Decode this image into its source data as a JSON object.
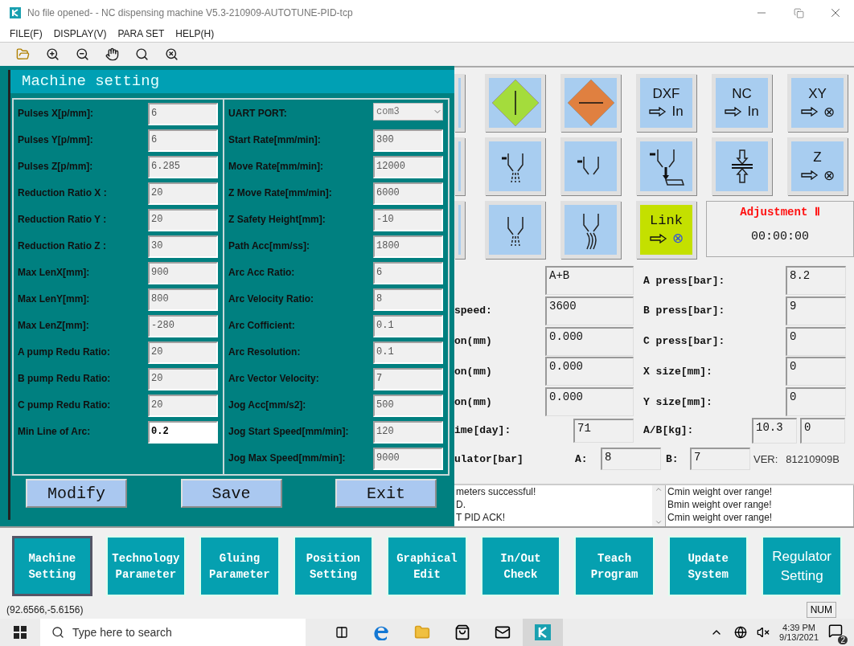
{
  "window": {
    "title": "No file opened- - NC dispensing machine V5.3-210909-AUTOTUNE-PID-tcp"
  },
  "menu": [
    "FILE(F)",
    "DISPLAY(V)",
    "PARA SET",
    "HELP(H)"
  ],
  "dialog": {
    "title": "Machine setting",
    "left": [
      {
        "label": "Pulses X[p/mm]:",
        "value": "6",
        "disabled": true
      },
      {
        "label": "Pulses Y[p/mm]:",
        "value": "6",
        "disabled": true
      },
      {
        "label": "Pulses Z[p/mm]:",
        "value": "6.285",
        "disabled": true
      },
      {
        "label": "Reduction Ratio X :",
        "value": "20",
        "disabled": true
      },
      {
        "label": "Reduction Ratio Y :",
        "value": "20",
        "disabled": true
      },
      {
        "label": "Reduction Ratio Z :",
        "value": "30",
        "disabled": true
      },
      {
        "label": "Max LenX[mm]:",
        "value": "900",
        "disabled": true
      },
      {
        "label": "Max LenY[mm]:",
        "value": "800",
        "disabled": true
      },
      {
        "label": "Max LenZ[mm]:",
        "value": "-280",
        "disabled": true
      },
      {
        "label": "A pump Redu Ratio:",
        "value": "20",
        "disabled": true
      },
      {
        "label": "B pump Redu Ratio:",
        "value": "20",
        "disabled": true
      },
      {
        "label": "C pump Redu Ratio:",
        "value": "20",
        "disabled": true
      },
      {
        "label": "Min Line of Arc:",
        "value": "0.2",
        "disabled": false
      }
    ],
    "right": [
      {
        "kind": "select",
        "label": "UART PORT:",
        "value": "com3",
        "disabled": true
      },
      {
        "kind": "field",
        "label": "Start Rate[mm/min]:",
        "value": "300",
        "disabled": true
      },
      {
        "kind": "field",
        "label": "Move Rate[mm/min]:",
        "value": "12000",
        "disabled": true
      },
      {
        "kind": "field",
        "label": "Z Move Rate[mm/min]:",
        "value": "6000",
        "disabled": true
      },
      {
        "kind": "field",
        "label": "Z Safety Height[mm]:",
        "value": "-10",
        "disabled": true
      },
      {
        "kind": "field",
        "label": "Path Acc[mm/ss]:",
        "value": "1800",
        "disabled": true
      },
      {
        "kind": "field",
        "label": "Arc Acc Ratio:",
        "value": "6",
        "disabled": true
      },
      {
        "kind": "field",
        "label": "Arc Velocity Ratio:",
        "value": "8",
        "disabled": true
      },
      {
        "kind": "field",
        "label": "Arc Cofficient:",
        "value": "0.1",
        "disabled": true
      },
      {
        "kind": "field",
        "label": "Arc Resolution:",
        "value": "0.1",
        "disabled": true
      },
      {
        "kind": "field",
        "label": "Arc Vector Velocity:",
        "value": "7",
        "disabled": true
      },
      {
        "kind": "field",
        "label": "Jog Acc[mm/s2]:",
        "value": "500",
        "disabled": true
      },
      {
        "kind": "field",
        "label": "Jog Start Speed[mm/min]:",
        "value": "120",
        "disabled": true
      },
      {
        "kind": "field",
        "label": "Jog Max Speed[mm/min]:",
        "value": "9000",
        "disabled": true
      }
    ],
    "buttons": [
      "Modify",
      "Save",
      "Exit"
    ]
  },
  "tools": [
    {
      "kind": "partial",
      "highlighted": false
    },
    {
      "kind": "diamond-vertical",
      "color": "#a4dc3c",
      "highlighted": false
    },
    {
      "kind": "diamond-horizontal",
      "color": "#e08040",
      "highlighted": false
    },
    {
      "kind": "text",
      "label": "DXF",
      "target": "In",
      "highlighted": false
    },
    {
      "kind": "text",
      "label": "NC",
      "target": "In",
      "highlighted": false
    },
    {
      "kind": "text",
      "label": "XY",
      "target": "⊗",
      "highlighted": false
    },
    {
      "kind": "partial",
      "highlighted": false
    },
    {
      "kind": "nozzle-spray",
      "highlighted": false
    },
    {
      "kind": "nozzle",
      "highlighted": false
    },
    {
      "kind": "nozzle-dispense",
      "highlighted": false
    },
    {
      "kind": "press",
      "highlighted": false
    },
    {
      "kind": "text",
      "label": "Z",
      "target": "⊗",
      "highlighted": false
    },
    {
      "kind": "partial",
      "highlighted": false
    },
    {
      "kind": "nozzle-drip",
      "highlighted": false
    },
    {
      "kind": "nozzle-stream",
      "highlighted": false
    },
    {
      "kind": "text",
      "label": "Link",
      "target": "⊗",
      "highlighted": true
    }
  ],
  "adjustment": {
    "title": "Adjustment Ⅱ",
    "timer": "00:00:00"
  },
  "info": {
    "rows": [
      {
        "label": "",
        "value": "A+B",
        "label2": "A press[bar]:",
        "value2": "8.2"
      },
      {
        "label": "speed:",
        "value": "3600",
        "label2": "B press[bar]:",
        "value2": "9"
      },
      {
        "label": "on(mm)",
        "value": "0.000",
        "label2": "C press[bar]:",
        "value2": "0"
      },
      {
        "label": "on(mm)",
        "value": "0.000",
        "label2": "X size[mm]:",
        "value2": "0"
      },
      {
        "label": "on(mm)",
        "value": "0.000",
        "label2": "Y size[mm]:",
        "value2": "0"
      }
    ],
    "day": {
      "label": "ime[day]:",
      "value": "71"
    },
    "weight": {
      "label": "A/B[kg]:",
      "values": [
        "10.3",
        "0"
      ]
    },
    "regulator": {
      "label": "ulator[bar]",
      "a_label": "A:",
      "a_value": "8",
      "b_label": "B:",
      "b_value": "7"
    },
    "version": {
      "label": "VER:",
      "value": "81210909B"
    }
  },
  "logs": [
    [
      "meters successful!",
      "D.",
      "T PID ACK!"
    ],
    [
      "Cmin weight over range!",
      "Bmin weight over range!",
      "Cmin weight over range!"
    ]
  ],
  "nav": [
    {
      "lines": [
        "Machine",
        "Setting"
      ],
      "selected": true,
      "kind": "serif"
    },
    {
      "lines": [
        "Technology",
        "Parameter"
      ],
      "selected": false,
      "kind": "serif"
    },
    {
      "lines": [
        "Gluing",
        "Parameter"
      ],
      "selected": false,
      "kind": "serif"
    },
    {
      "lines": [
        "Position",
        "Setting"
      ],
      "selected": false,
      "kind": "serif"
    },
    {
      "lines": [
        "Graphical",
        "Edit"
      ],
      "selected": false,
      "kind": "serif"
    },
    {
      "lines": [
        "In/Out",
        "Check"
      ],
      "selected": false,
      "kind": "serif"
    },
    {
      "lines": [
        "Teach",
        "Program"
      ],
      "selected": false,
      "kind": "serif"
    },
    {
      "lines": [
        "Update",
        "System"
      ],
      "selected": false,
      "kind": "serif"
    },
    {
      "lines": [
        "Regulator",
        "Setting"
      ],
      "selected": false,
      "kind": "sans"
    }
  ],
  "status_bar": {
    "coords": "(92.6566,-5.6156)",
    "indicator": "NUM"
  },
  "taskbar": {
    "search_placeholder": "Type here to search",
    "time": "4:39 PM",
    "date": "9/13/2021",
    "notifications": "2"
  }
}
